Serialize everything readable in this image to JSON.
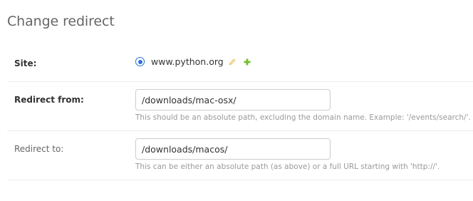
{
  "page": {
    "title": "Change redirect"
  },
  "form": {
    "site": {
      "label": "Site:",
      "selected_option": "www.python.org",
      "edit_icon": "pencil-icon",
      "add_icon": "plus-icon"
    },
    "redirect_from": {
      "label": "Redirect from:",
      "value": "/downloads/mac-osx/",
      "help": "This should be an absolute path, excluding the domain name. Example: '/events/search/'."
    },
    "redirect_to": {
      "label": "Redirect to:",
      "value": "/downloads/macos/",
      "help": "This can be either an absolute path (as above) or a full URL starting with 'http://'."
    }
  },
  "colors": {
    "radio_accent": "#2b73d6",
    "edit_icon": "#f0d48a",
    "add_icon": "#70bf2b"
  }
}
